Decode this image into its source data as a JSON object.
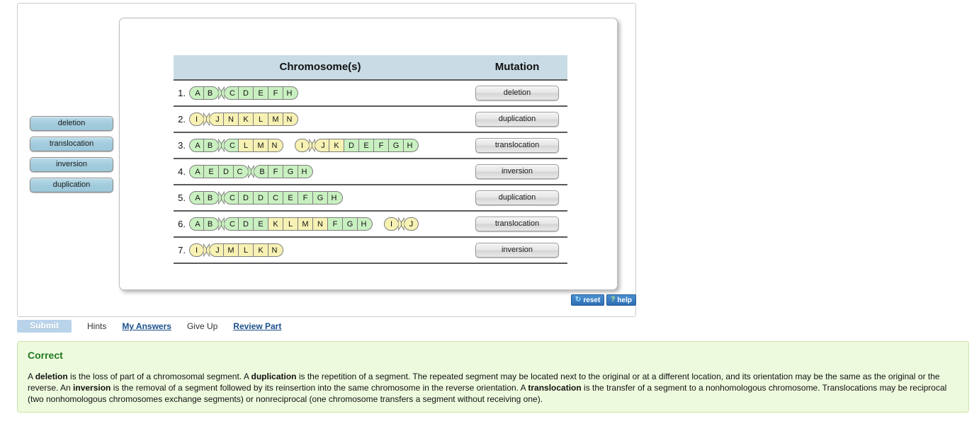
{
  "drag_bank": {
    "items": [
      {
        "label": "deletion"
      },
      {
        "label": "translocation"
      },
      {
        "label": "inversion"
      },
      {
        "label": "duplication"
      }
    ]
  },
  "table": {
    "headers": {
      "chromosomes": "Chromosome(s)",
      "mutation": "Mutation"
    },
    "rows": [
      {
        "num": "1.",
        "answer": "deletion",
        "chromosomes": [
          {
            "left": [
              {
                "t": "A",
                "c": "g"
              },
              {
                "t": "B",
                "c": "g"
              }
            ],
            "right": [
              {
                "t": "C",
                "c": "g"
              },
              {
                "t": "D",
                "c": "g"
              },
              {
                "t": "E",
                "c": "g"
              },
              {
                "t": "F",
                "c": "g"
              },
              {
                "t": "H",
                "c": "g"
              }
            ]
          }
        ]
      },
      {
        "num": "2.",
        "answer": "duplication",
        "chromosomes": [
          {
            "left": [
              {
                "t": "I",
                "c": "y"
              }
            ],
            "right": [
              {
                "t": "J",
                "c": "y"
              },
              {
                "t": "N",
                "c": "y"
              },
              {
                "t": "K",
                "c": "y"
              },
              {
                "t": "L",
                "c": "y"
              },
              {
                "t": "M",
                "c": "y"
              },
              {
                "t": "N",
                "c": "y"
              }
            ]
          }
        ]
      },
      {
        "num": "3.",
        "answer": "translocation",
        "chromosomes": [
          {
            "left": [
              {
                "t": "A",
                "c": "g"
              },
              {
                "t": "B",
                "c": "g"
              }
            ],
            "right": [
              {
                "t": "C",
                "c": "g"
              },
              {
                "t": "L",
                "c": "y"
              },
              {
                "t": "M",
                "c": "y"
              },
              {
                "t": "N",
                "c": "y"
              }
            ]
          },
          {
            "left": [
              {
                "t": "I",
                "c": "y"
              }
            ],
            "right": [
              {
                "t": "J",
                "c": "y"
              },
              {
                "t": "K",
                "c": "y"
              },
              {
                "t": "D",
                "c": "g"
              },
              {
                "t": "E",
                "c": "g"
              },
              {
                "t": "F",
                "c": "g"
              },
              {
                "t": "G",
                "c": "g"
              },
              {
                "t": "H",
                "c": "g"
              }
            ]
          }
        ]
      },
      {
        "num": "4.",
        "answer": "inversion",
        "chromosomes": [
          {
            "left": [
              {
                "t": "A",
                "c": "g"
              },
              {
                "t": "E",
                "c": "g"
              },
              {
                "t": "D",
                "c": "g"
              },
              {
                "t": "C",
                "c": "g"
              }
            ],
            "right": [
              {
                "t": "B",
                "c": "g"
              },
              {
                "t": "F",
                "c": "g"
              },
              {
                "t": "G",
                "c": "g"
              },
              {
                "t": "H",
                "c": "g"
              }
            ]
          }
        ]
      },
      {
        "num": "5.",
        "answer": "duplication",
        "chromosomes": [
          {
            "left": [
              {
                "t": "A",
                "c": "g"
              },
              {
                "t": "B",
                "c": "g"
              }
            ],
            "right": [
              {
                "t": "C",
                "c": "g"
              },
              {
                "t": "D",
                "c": "g"
              },
              {
                "t": "D",
                "c": "g"
              },
              {
                "t": "C",
                "c": "g"
              },
              {
                "t": "E",
                "c": "g"
              },
              {
                "t": "F",
                "c": "g"
              },
              {
                "t": "G",
                "c": "g"
              },
              {
                "t": "H",
                "c": "g"
              }
            ]
          }
        ]
      },
      {
        "num": "6.",
        "answer": "translocation",
        "chromosomes": [
          {
            "left": [
              {
                "t": "A",
                "c": "g"
              },
              {
                "t": "B",
                "c": "g"
              }
            ],
            "right": [
              {
                "t": "C",
                "c": "g"
              },
              {
                "t": "D",
                "c": "g"
              },
              {
                "t": "E",
                "c": "g"
              },
              {
                "t": "K",
                "c": "y"
              },
              {
                "t": "L",
                "c": "y"
              },
              {
                "t": "M",
                "c": "y"
              },
              {
                "t": "N",
                "c": "y"
              },
              {
                "t": "F",
                "c": "g"
              },
              {
                "t": "G",
                "c": "g"
              },
              {
                "t": "H",
                "c": "g"
              }
            ]
          },
          {
            "left": [
              {
                "t": "I",
                "c": "y"
              }
            ],
            "right": [
              {
                "t": "J",
                "c": "y"
              }
            ]
          }
        ]
      },
      {
        "num": "7.",
        "answer": "inversion",
        "chromosomes": [
          {
            "left": [
              {
                "t": "I",
                "c": "y"
              }
            ],
            "right": [
              {
                "t": "J",
                "c": "y"
              },
              {
                "t": "M",
                "c": "y"
              },
              {
                "t": "L",
                "c": "y"
              },
              {
                "t": "K",
                "c": "y"
              },
              {
                "t": "N",
                "c": "y"
              }
            ]
          }
        ]
      }
    ]
  },
  "tools": {
    "reset_label": "reset",
    "reset_icon": "refresh-icon",
    "help_label": "help",
    "help_icon": "question-mark-icon"
  },
  "actions": {
    "submit": "Submit",
    "hints": "Hints",
    "my_answers": "My Answers",
    "give_up": "Give Up",
    "review_part": "Review Part"
  },
  "feedback": {
    "title": "Correct",
    "paragraph_parts": [
      {
        "text": "A ",
        "bold": false
      },
      {
        "text": "deletion",
        "bold": true
      },
      {
        "text": " is the loss of part of a chromosomal segment. A ",
        "bold": false
      },
      {
        "text": "duplication",
        "bold": true
      },
      {
        "text": " is the repetition of a segment. The repeated segment may be located next to the original or at a different location, and its orientation may be the same as the original or the reverse. An ",
        "bold": false
      },
      {
        "text": "inversion",
        "bold": true
      },
      {
        "text": " is the removal of a segment followed by its reinsertion into the same chromosome in the reverse orientation. A ",
        "bold": false
      },
      {
        "text": "translocation",
        "bold": true
      },
      {
        "text": " is the transfer of a segment to a nonhomologous chromosome. Translocations may be reciprocal (two nonhomologous chromosomes exchange segments) or nonreciprocal (one chromosome transfers a segment without receiving one).",
        "bold": false
      }
    ]
  },
  "colors": {
    "header_bg": "#c9dce5",
    "green_segment": "#c9f0c0",
    "yellow_segment": "#f7f1b4",
    "drag_label_bg": "#a3ccdd",
    "feedback_bg": "#eefade",
    "correct_green": "#1f7a1f",
    "tool_blue": "#2f6fb5"
  }
}
